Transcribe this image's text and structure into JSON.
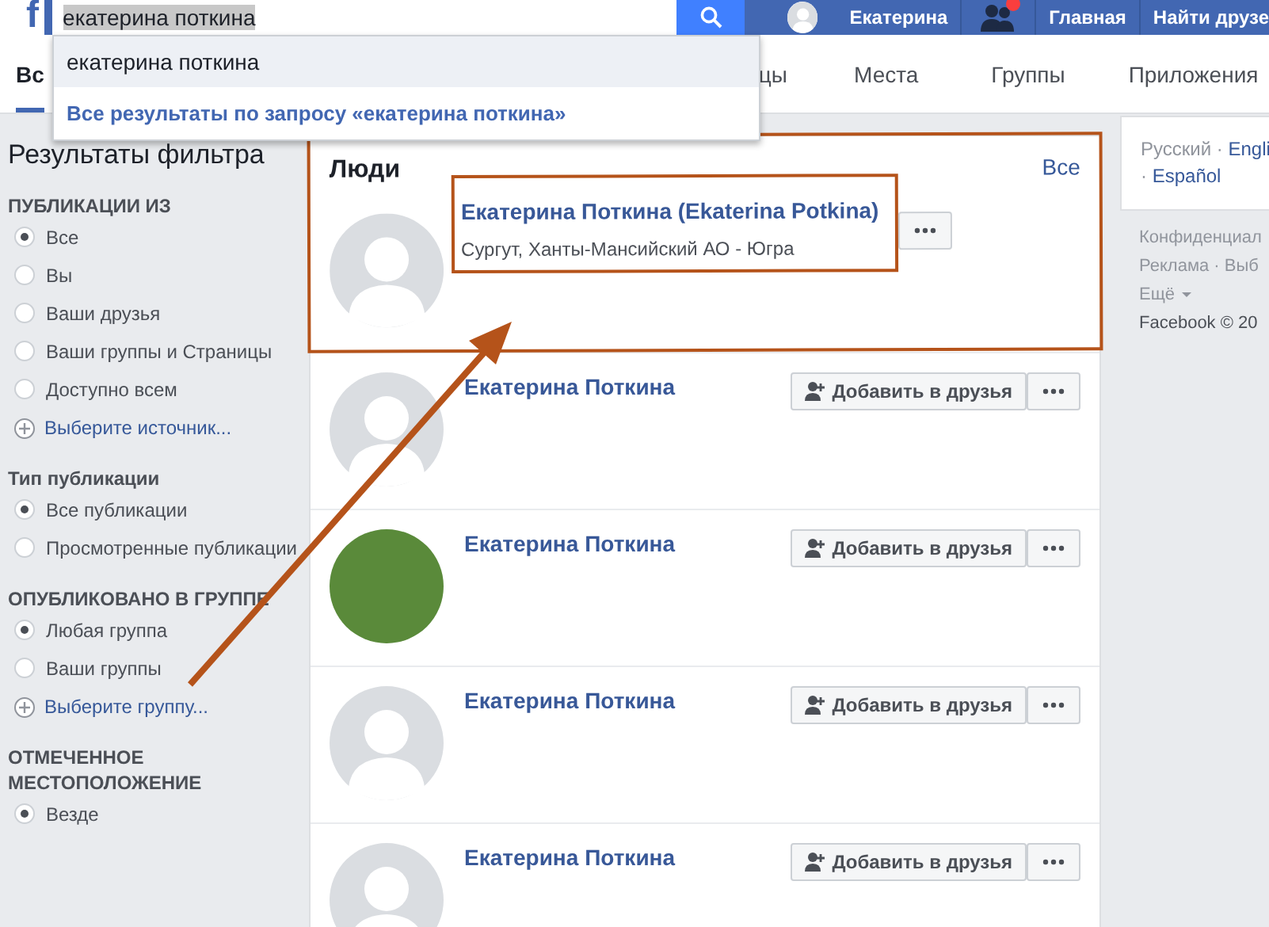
{
  "topbar": {
    "logo": "f",
    "search": {
      "value": "екатерина поткина"
    },
    "user": {
      "name": "Екатерина"
    },
    "friend_requests": {
      "has_new": true
    },
    "links": [
      "Главная",
      "Найти друзе"
    ]
  },
  "suggestions": [
    {
      "text": "екатерина поткина",
      "kind": "query",
      "selected": true
    },
    {
      "text": "Все результаты по запросу «екатерина поткина»",
      "kind": "all",
      "selected": false
    }
  ],
  "tabs": [
    {
      "label": "Вс",
      "selected": true
    },
    {
      "label": "цы",
      "selected": false
    },
    {
      "label": "Места",
      "selected": false
    },
    {
      "label": "Группы",
      "selected": false
    },
    {
      "label": "Приложения",
      "selected": false
    }
  ],
  "filters": {
    "title": "Результаты фильтра",
    "sections": [
      {
        "heading": "ПУБЛИКАЦИИ ИЗ",
        "options": [
          {
            "label": "Все",
            "selected": true
          },
          {
            "label": "Вы",
            "selected": false
          },
          {
            "label": "Ваши друзья",
            "selected": false
          },
          {
            "label": "Ваши группы и Страницы",
            "selected": false
          },
          {
            "label": "Доступно всем",
            "selected": false
          }
        ],
        "more": "Выберите источник..."
      },
      {
        "heading": "Тип публикации",
        "options": [
          {
            "label": "Все публикации",
            "selected": true
          },
          {
            "label": "Просмотренные публикации",
            "selected": false
          }
        ]
      },
      {
        "heading": "ОПУБЛИКОВАНО В ГРУППЕ",
        "options": [
          {
            "label": "Любая группа",
            "selected": true
          },
          {
            "label": "Ваши группы",
            "selected": false
          }
        ],
        "more": "Выберите группу..."
      },
      {
        "heading": "ОТМЕЧЕННОЕ МЕСТОПОЛОЖЕНИЕ",
        "options": [
          {
            "label": "Везде",
            "selected": true
          }
        ]
      }
    ]
  },
  "people": {
    "title": "Люди",
    "see_all": "Все",
    "highlighted": true,
    "results": [
      {
        "name": "Екатерина Поткина (Ekaterina Potkina)",
        "location": "Сургут, Ханты-Мансийский АО - Югра",
        "kind": "default",
        "highlighted": true
      },
      {
        "name": "Екатерина Поткина",
        "kind": "default",
        "highlighted": false,
        "action": "Добавить в друзья"
      },
      {
        "name": "Екатерина Поткина",
        "kind": "photo",
        "highlighted": false,
        "action": "Добавить в друзья"
      },
      {
        "name": "Екатерина Поткина",
        "kind": "default",
        "highlighted": false,
        "action": "Добавить в друзья"
      },
      {
        "name": "Екатерина Поткина",
        "kind": "default",
        "highlighted": false,
        "action": "Добавить в друзья"
      }
    ]
  },
  "languages": {
    "separator": "·",
    "items": [
      {
        "label": "Русский",
        "selected": true
      },
      {
        "label": "Engli",
        "selected": false
      },
      {
        "label": "Español",
        "selected": false
      }
    ]
  },
  "footer": [
    {
      "text": "Конфиденциал",
      "kind": "link"
    },
    {
      "text": "Реклама · Выб",
      "kind": "link"
    },
    {
      "text": "Ещё",
      "kind": "menu"
    },
    {
      "text": "Facebook © 20",
      "kind": "copyright"
    }
  ]
}
